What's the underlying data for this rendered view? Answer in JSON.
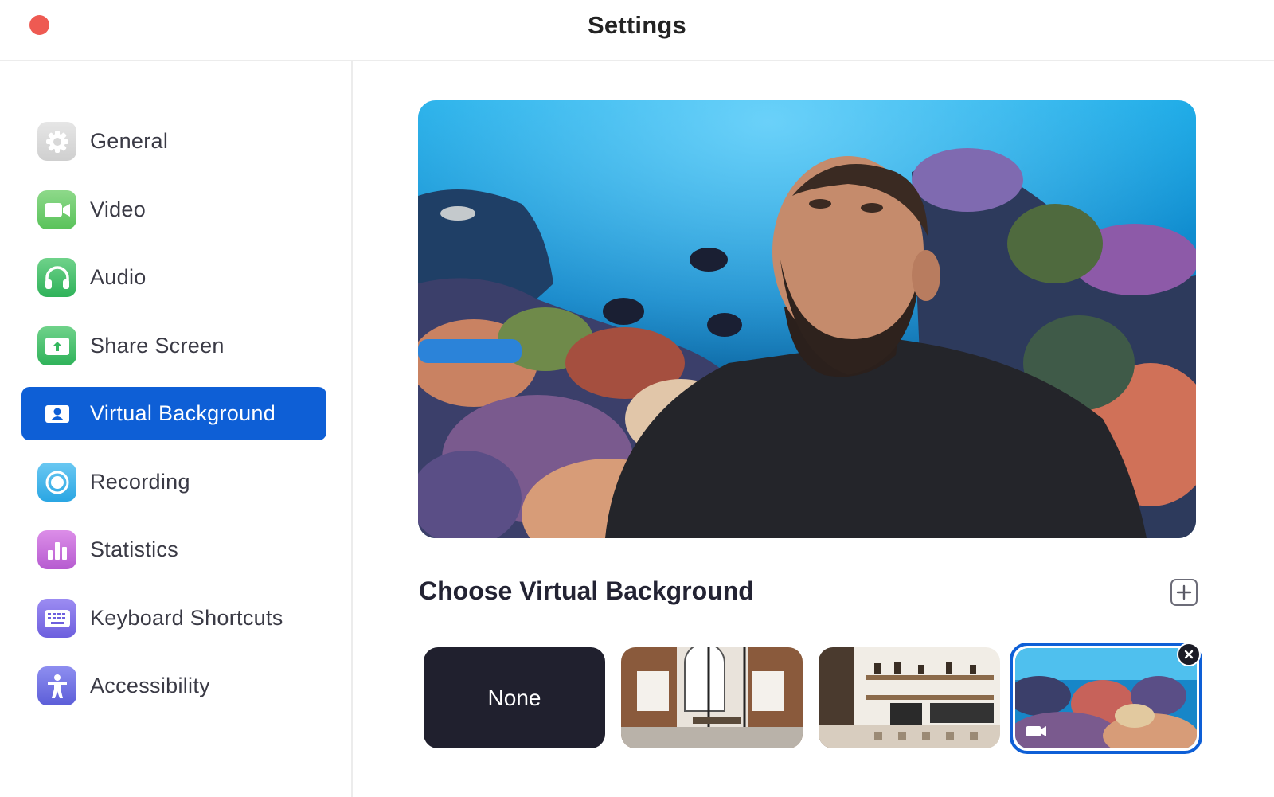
{
  "window": {
    "title": "Settings"
  },
  "sidebar": {
    "items": [
      {
        "label": "General",
        "icon": "gear-icon"
      },
      {
        "label": "Video",
        "icon": "video-camera-icon"
      },
      {
        "label": "Audio",
        "icon": "headphones-icon"
      },
      {
        "label": "Share Screen",
        "icon": "share-screen-icon"
      },
      {
        "label": "Virtual Background",
        "icon": "person-portrait-icon",
        "active": true
      },
      {
        "label": "Recording",
        "icon": "record-icon"
      },
      {
        "label": "Statistics",
        "icon": "bar-chart-icon"
      },
      {
        "label": "Keyboard Shortcuts",
        "icon": "keyboard-icon"
      },
      {
        "label": "Accessibility",
        "icon": "accessibility-icon"
      }
    ]
  },
  "main": {
    "section_title": "Choose Virtual Background",
    "add_icon": "plus-icon",
    "backgrounds": [
      {
        "label": "None"
      },
      {
        "label": "",
        "kind": "office"
      },
      {
        "label": "",
        "kind": "cafe"
      },
      {
        "label": "",
        "kind": "ocean",
        "selected": true
      }
    ]
  },
  "colors": {
    "accent": "#0e5fd6",
    "close_button": "#ee5a52",
    "none_tile": "#20202e"
  }
}
